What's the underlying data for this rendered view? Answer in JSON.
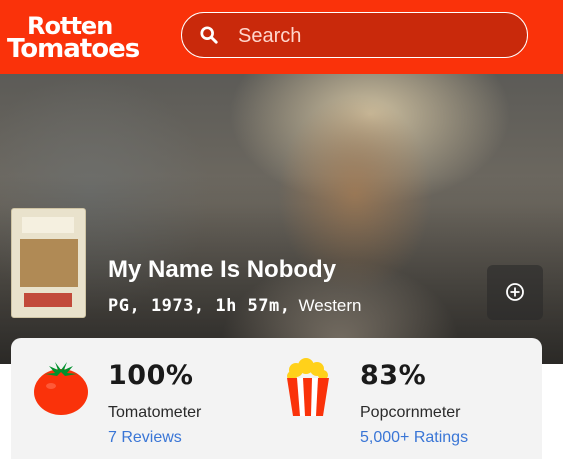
{
  "header": {
    "logo_line1": "Rotten",
    "logo_line2": "Tomatoes",
    "search_placeholder": "Search",
    "colors": {
      "brand": "#fa320a"
    }
  },
  "movie": {
    "title": "My Name Is Nobody",
    "rating_year_runtime": "PG, 1973, 1h 57m,",
    "genre": "Western"
  },
  "scores": {
    "tomatometer": {
      "value": "100%",
      "label": "Tomatometer",
      "count": "7 Reviews",
      "icon": "tomato-icon"
    },
    "popcornmeter": {
      "value": "83%",
      "label": "Popcornmeter",
      "count": "5,000+ Ratings",
      "icon": "popcorn-icon"
    }
  }
}
